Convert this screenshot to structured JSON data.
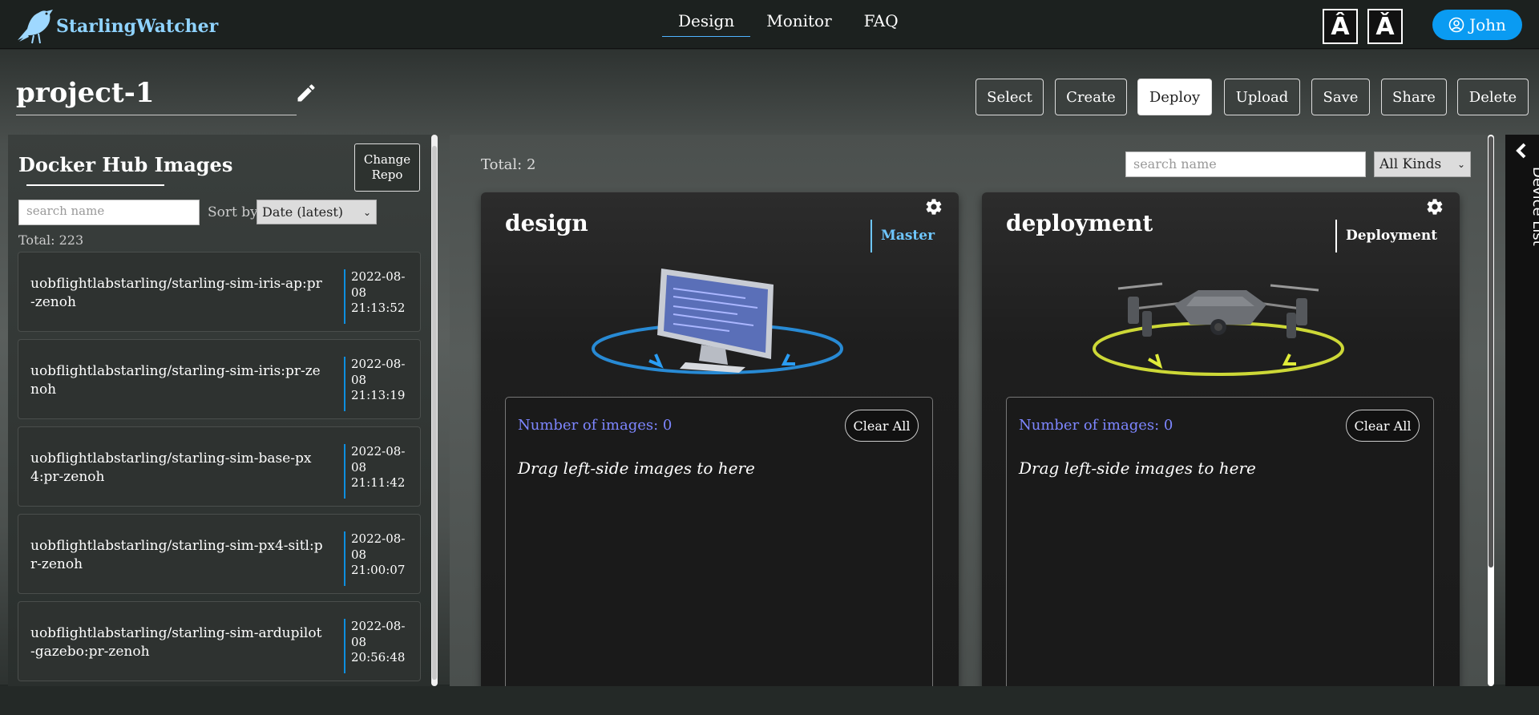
{
  "app": {
    "brand": "StarlingWatcher"
  },
  "nav": {
    "links": [
      "Design",
      "Monitor",
      "FAQ"
    ],
    "active": "Design",
    "font_increase": "Â",
    "font_decrease": "Ǎ",
    "user": "John"
  },
  "project": {
    "name": "project-1"
  },
  "actions": [
    "Select",
    "Create",
    "Deploy",
    "Upload",
    "Save",
    "Share",
    "Delete"
  ],
  "active_action": "Deploy",
  "images_panel": {
    "title": "Docker Hub Images",
    "change_repo": "Change Repo",
    "search_placeholder": "search name",
    "sort_label": "Sort by",
    "sort_value": "Date (latest)",
    "total": "Total: 223",
    "items": [
      {
        "name": "uobflightlabstarling/starling-sim-iris-ap:pr-zenoh",
        "date": "2022-08-08 21:13:52"
      },
      {
        "name": "uobflightlabstarling/starling-sim-iris:pr-zenoh",
        "date": "2022-08-08 21:13:19"
      },
      {
        "name": "uobflightlabstarling/starling-sim-base-px4:pr-zenoh",
        "date": "2022-08-08 21:11:42"
      },
      {
        "name": "uobflightlabstarling/starling-sim-px4-sitl:pr-zenoh",
        "date": "2022-08-08 21:00:07"
      },
      {
        "name": "uobflightlabstarling/starling-sim-ardupilot-gazebo:pr-zenoh",
        "date": "2022-08-08 20:56:48"
      }
    ]
  },
  "kinds_panel": {
    "total": "Total: 2",
    "search_placeholder": "search name",
    "kind_filter": "All Kinds",
    "cards": [
      {
        "title": "design",
        "kind": "Master",
        "kind_color": "#6ec6ff",
        "num_images": "Number of images: 0",
        "clear_label": "Clear All",
        "drop_hint": "Drag left-side images to here"
      },
      {
        "title": "deployment",
        "kind": "Deployment",
        "kind_color": "#ffffff",
        "num_images": "Number of images: 0",
        "clear_label": "Clear All",
        "drop_hint": "Drag left-side images to here"
      }
    ]
  },
  "device_list": {
    "label": "Device List"
  },
  "colors": {
    "brand": "#8fd3ff",
    "accent": "#0a9bf2",
    "count_text": "#7d86ff",
    "date_border": "#0d8fe0"
  },
  "icons": [
    "starling-bird-icon",
    "user-circle-icon",
    "pencil-icon",
    "gear-icon",
    "chevron-left-icon",
    "monitor-illustration",
    "drone-illustration"
  ]
}
